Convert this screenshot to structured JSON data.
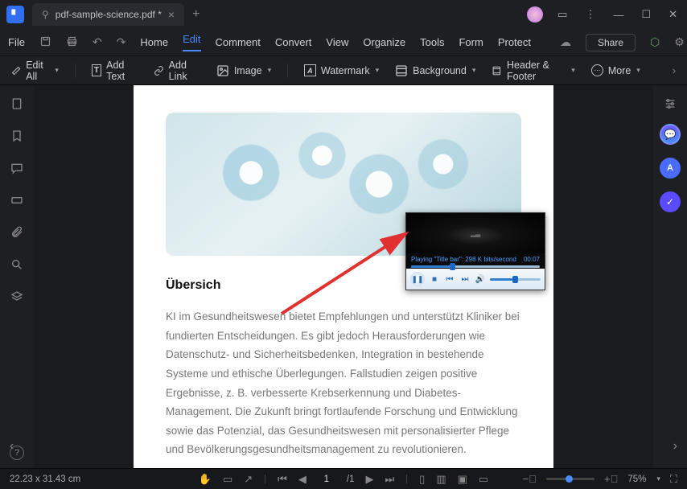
{
  "titlebar": {
    "tab_title": "pdf-sample-science.pdf *"
  },
  "menubar": {
    "file": "File",
    "items": [
      "Home",
      "Edit",
      "Comment",
      "Convert",
      "View",
      "Organize",
      "Tools",
      "Form",
      "Protect"
    ],
    "active_index": 1,
    "share": "Share"
  },
  "toolbar": {
    "edit_all": "Edit All",
    "add_text": "Add Text",
    "add_link": "Add Link",
    "image": "Image",
    "watermark": "Watermark",
    "background": "Background",
    "header_footer": "Header & Footer",
    "more": "More"
  },
  "document": {
    "heading": "Übersich",
    "body": "KI im Gesundheitswesen bietet Empfehlungen und unterstützt Kliniker bei fundierten Entscheidungen.   Es gibt jedoch Herausforderungen wie Datenschutz- und Sicherheitsbedenken, Integration in bestehende Systeme und ethische Überlegungen. Fallstudien zeigen positive Ergebnisse, z. B.   verbesserte Krebserkennung und Diabetes-Management. Die Zukunft bringt fortlaufende Forschung   und Entwicklung sowie das Potenzial, das Gesundheitswesen mit personalisierter Pflege und Bevölkerungsgesundheitsmanagement zu revolutionieren."
  },
  "media_player": {
    "status_text": "Playing \"Title bar\": 298 K bits/second",
    "time": "00:07"
  },
  "statusbar": {
    "dimensions": "22.23 x 31.43 cm",
    "page_current": "1",
    "page_total": "/1",
    "zoom": "75%"
  }
}
